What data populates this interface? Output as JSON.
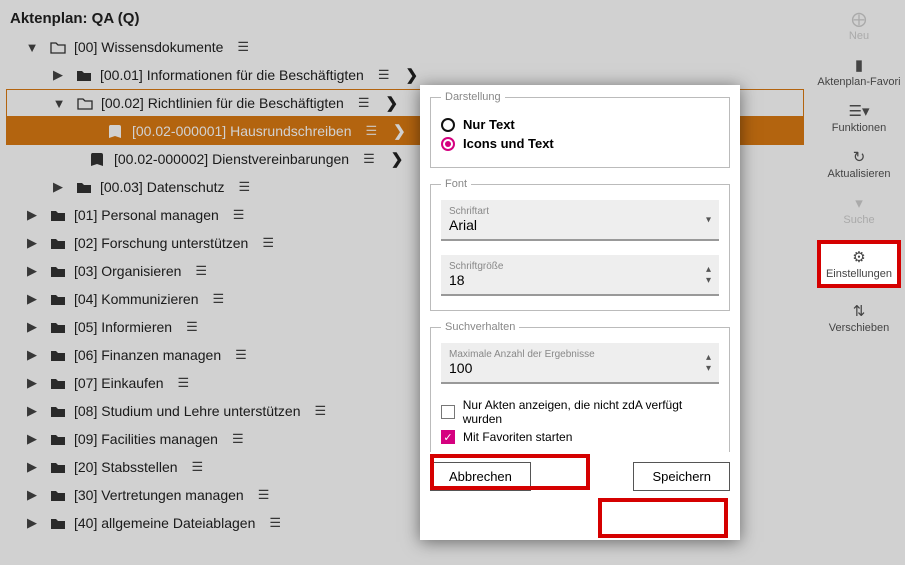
{
  "title": "Aktenplan: QA (Q)",
  "tree": {
    "root": "[00] Wissensdokumente",
    "c1": "[00.01] Informationen für die Beschäftigten",
    "c2": "[00.02] Richtlinien für die Beschäftigten",
    "c2a": "[00.02-000001] Hausrundschreiben",
    "c2b": "[00.02-000002] Dienstvereinbarungen",
    "c3": "[00.03] Datenschutz",
    "n01": "[01] Personal managen",
    "n02": "[02] Forschung unterstützen",
    "n03": "[03] Organisieren",
    "n04": "[04] Kommunizieren",
    "n05": "[05] Informieren",
    "n06": "[06] Finanzen managen",
    "n07": "[07] Einkaufen",
    "n08": "[08] Studium und Lehre unterstützen",
    "n09": "[09] Facilities managen",
    "n20": "[20] Stabsstellen",
    "n30": "[30] Vertretungen managen",
    "n40": "[40] allgemeine Dateiablagen"
  },
  "sidebar": {
    "neu": "Neu",
    "fav": "Aktenplan-Favori",
    "funk": "Funktionen",
    "akt": "Aktualisieren",
    "suche": "Suche",
    "einst": "Einstellungen",
    "versch": "Verschieben"
  },
  "dialog": {
    "darstellung_legend": "Darstellung",
    "radio_text": "Nur Text",
    "radio_icons": "Icons und Text",
    "font_legend": "Font",
    "schriftart_label": "Schriftart",
    "schriftart_value": "Arial",
    "schriftgroesse_label": "Schriftgröße",
    "schriftgroesse_value": "18",
    "such_legend": "Suchverhalten",
    "max_label": "Maximale Anzahl der Ergebnisse",
    "max_value": "100",
    "chk_akten": "Nur Akten anzeigen, die nicht zdA verfügt wurden",
    "chk_fav": "Mit Favoriten starten",
    "cancel": "Abbrechen",
    "save": "Speichern"
  }
}
